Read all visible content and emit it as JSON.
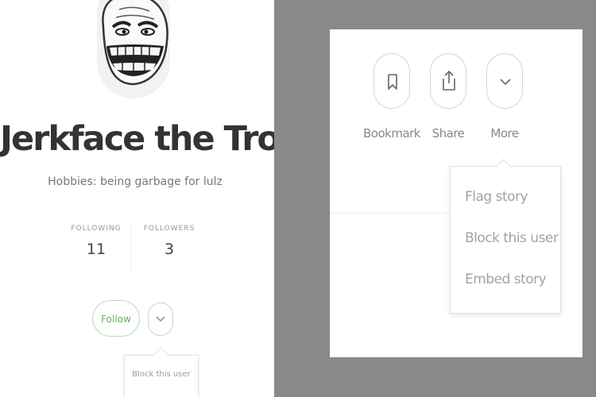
{
  "profile": {
    "name": "Jerkface the Troll",
    "bio": "Hobbies: being garbage for lulz",
    "following_label": "FOLLOWING",
    "following_count": "11",
    "followers_label": "FOLLOWERS",
    "followers_count": "3",
    "follow_label": "Follow",
    "menu_item": "Block this user"
  },
  "story_actions": {
    "bookmark_label": "Bookmark",
    "share_label": "Share",
    "more_label": "More",
    "menu_items": [
      "Flag story",
      "Block this user",
      "Embed story"
    ]
  },
  "icons": {
    "avatar": "troll-face-avatar",
    "bookmark": "bookmark-icon",
    "share": "share-icon",
    "more": "chevron-down-icon"
  },
  "colors": {
    "follow_accent": "#6aae5f",
    "right_background": "#898989",
    "heading_text": "#333333"
  }
}
